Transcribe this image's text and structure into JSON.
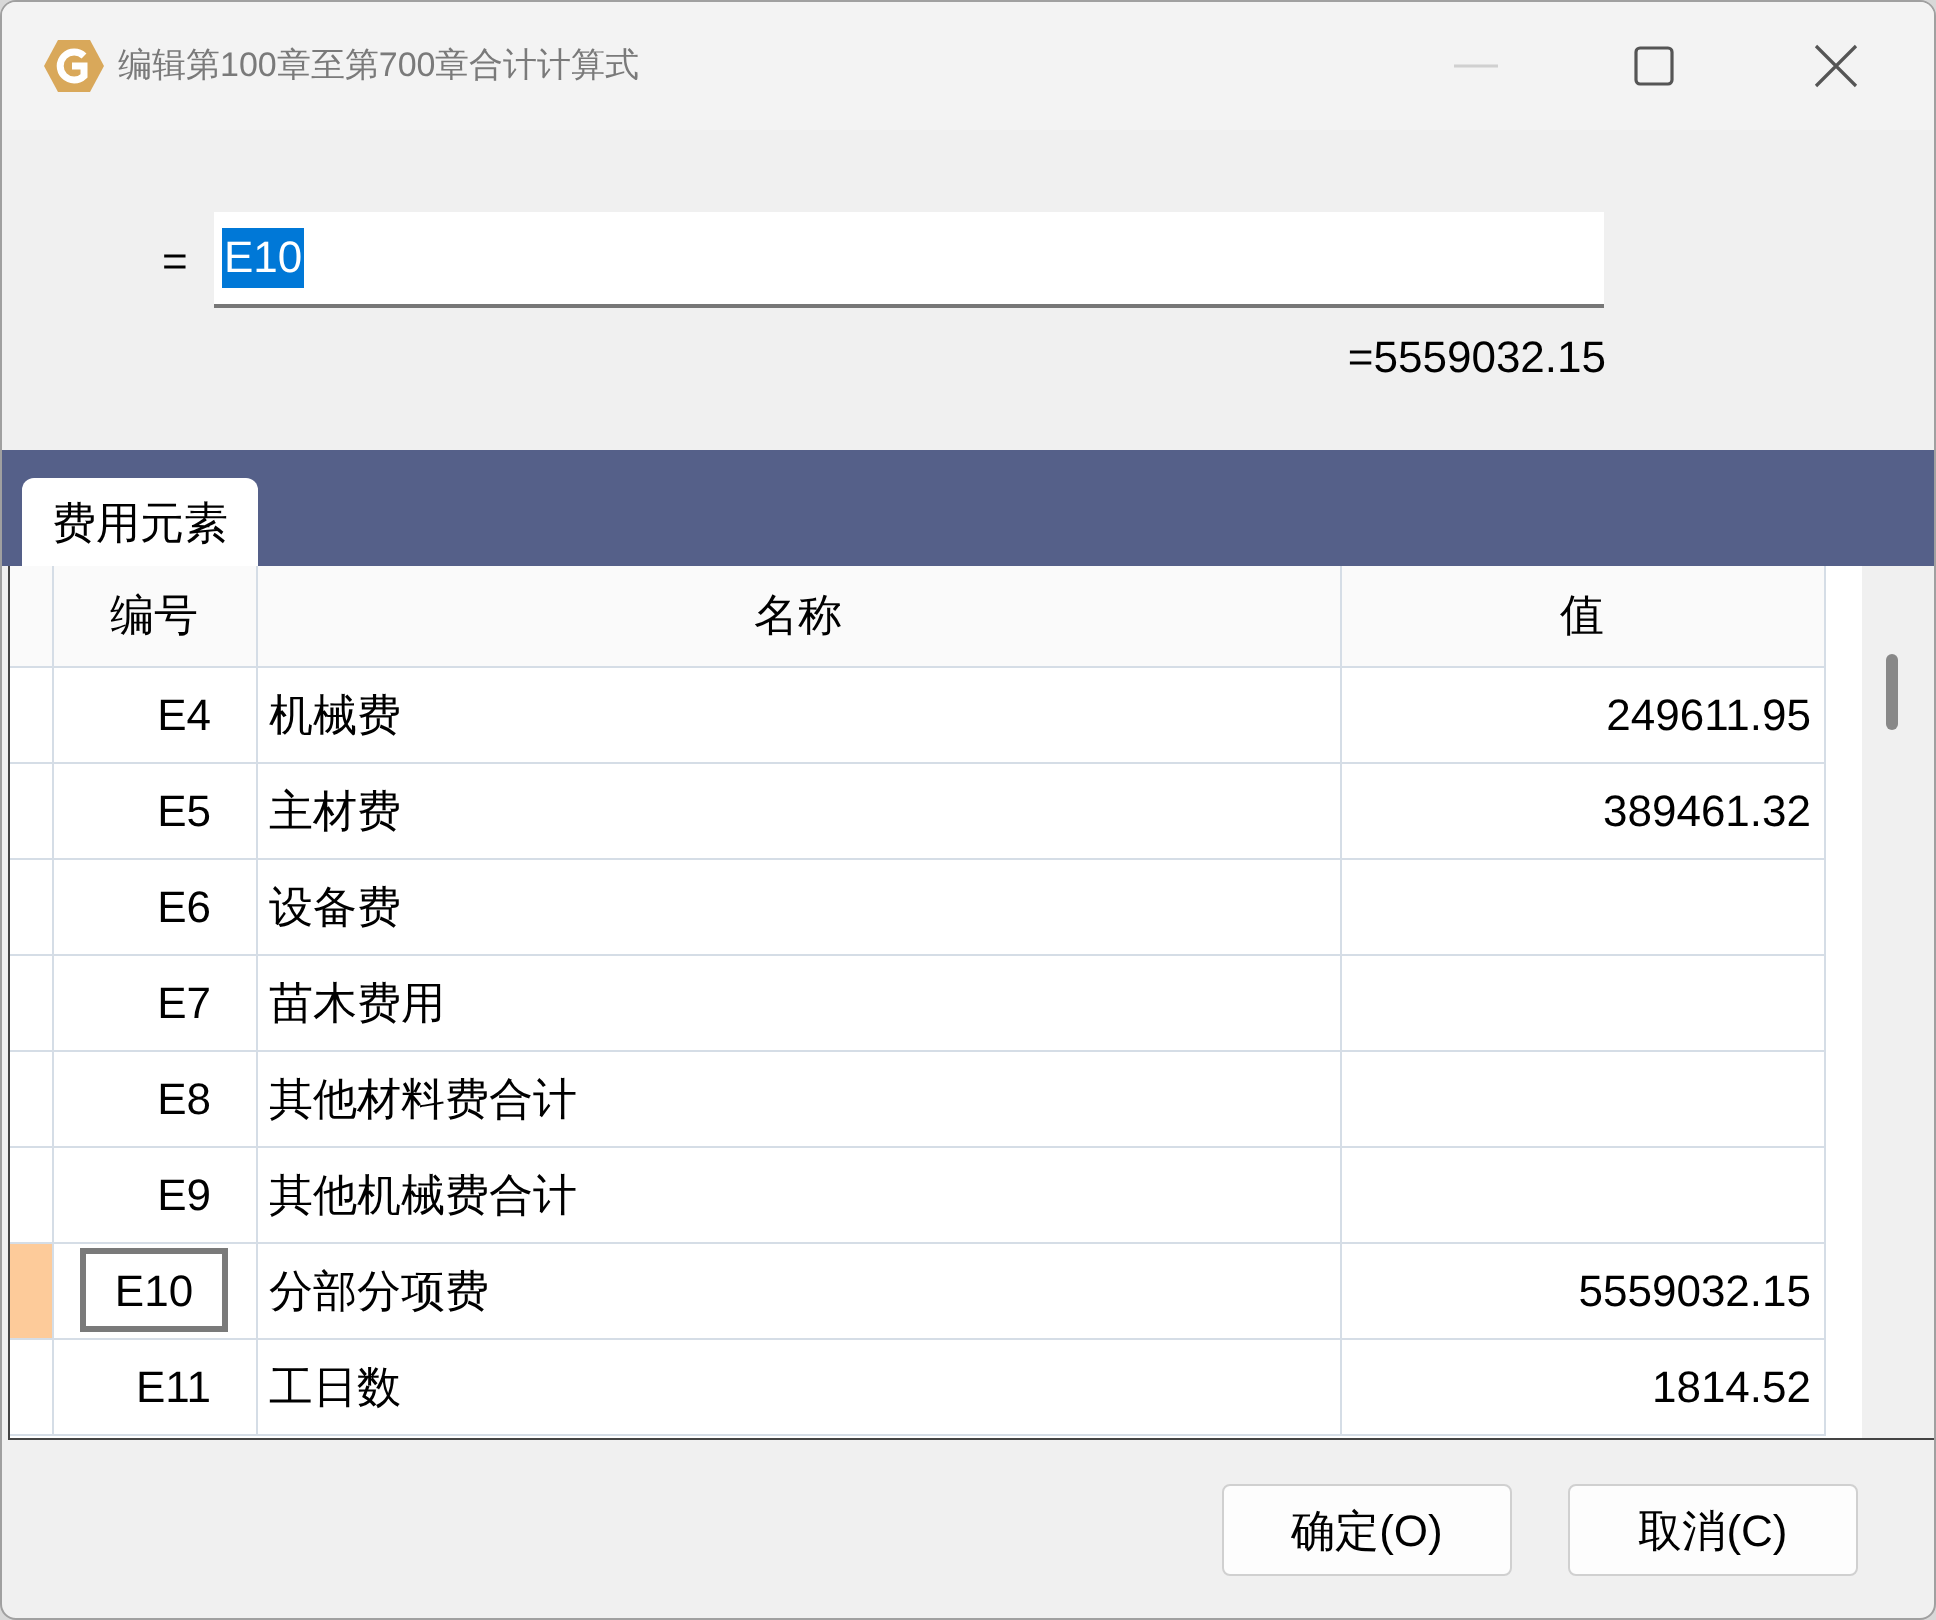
{
  "window": {
    "title": "编辑第100章至第700章合计计算式"
  },
  "formula": {
    "prefix": "=",
    "value": "E10",
    "result": "=5559032.15"
  },
  "tabs": [
    {
      "label": "费用元素",
      "selected": true
    }
  ],
  "table": {
    "columns": [
      "编号",
      "名称",
      "值"
    ],
    "rows": [
      {
        "code": "E4",
        "name": "机械费",
        "value": "249611.95",
        "selected": false
      },
      {
        "code": "E5",
        "name": "主材费",
        "value": "389461.32",
        "selected": false
      },
      {
        "code": "E6",
        "name": "设备费",
        "value": "",
        "selected": false
      },
      {
        "code": "E7",
        "name": "苗木费用",
        "value": "",
        "selected": false
      },
      {
        "code": "E8",
        "name": "其他材料费合计",
        "value": "",
        "selected": false
      },
      {
        "code": "E9",
        "name": "其他机械费合计",
        "value": "",
        "selected": false
      },
      {
        "code": "E10",
        "name": "分部分项费",
        "value": "5559032.15",
        "selected": true
      },
      {
        "code": "E11",
        "name": "工日数",
        "value": "1814.52",
        "selected": false
      }
    ]
  },
  "buttons": [
    "确定(O)",
    "取消(C)"
  ]
}
